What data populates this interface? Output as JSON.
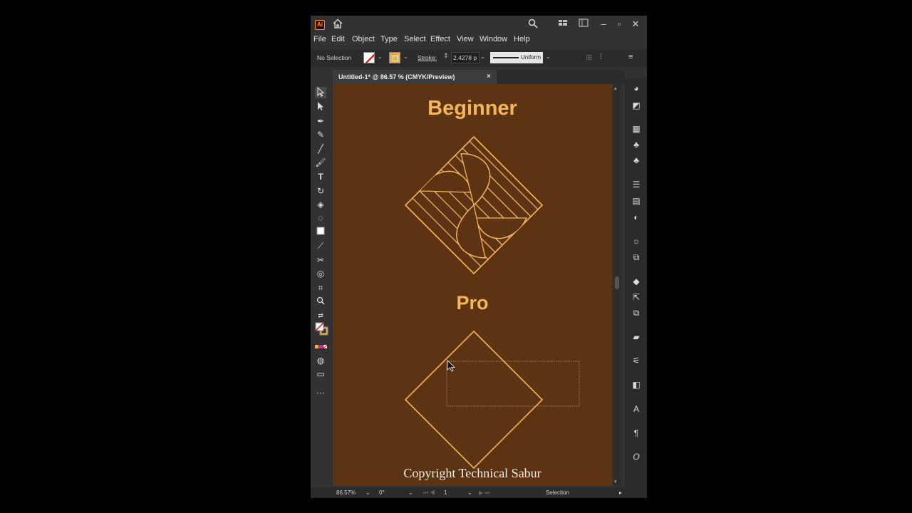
{
  "app": {
    "logo": "Ai",
    "icons": [
      "home-icon",
      "search-icon",
      "arrange-documents-icon",
      "panel-layout-icon",
      "minimize-icon",
      "maximize-icon",
      "close-icon"
    ]
  },
  "menu": [
    "File",
    "Edit",
    "Object",
    "Type",
    "Select",
    "Effect",
    "View",
    "Window",
    "Help"
  ],
  "control_bar": {
    "selection": "No Selection",
    "stroke_label": "Stroke:",
    "stroke_weight": "2.4278 p",
    "profile": "Uniform"
  },
  "document_tab": {
    "title": "Untitled-1* @ 86.57 % (CMYK/Preview)",
    "close": "×"
  },
  "artboard": {
    "heading_top": "Beginner",
    "heading_bottom": "Pro",
    "copyright": "Copyright Technical Sabur",
    "background_color": "#5c3414",
    "accent_color": "#f4b657"
  },
  "status_bar": {
    "zoom": "86.57%",
    "rotation": "0°",
    "artboard_number": "1",
    "tool": "Selection"
  }
}
